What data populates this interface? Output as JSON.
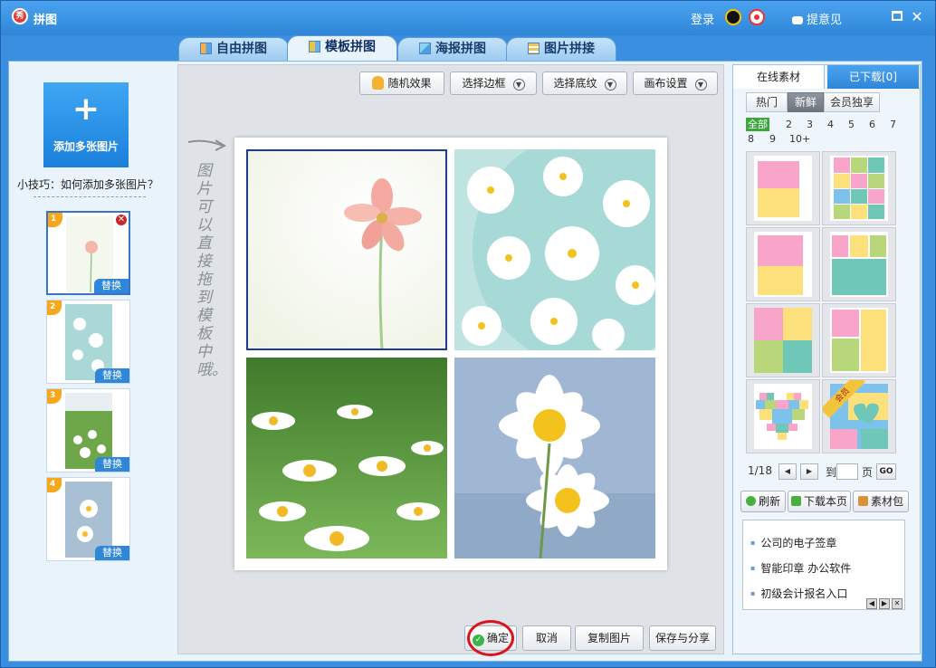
{
  "window": {
    "title": "拼图",
    "logo_text": "秀",
    "login": "登录",
    "feedback": "提意见",
    "maximize_icon": "maximize-icon",
    "close_icon": "close-icon"
  },
  "tabs": [
    {
      "label": "自由拼图",
      "active": false
    },
    {
      "label": "模板拼图",
      "active": true
    },
    {
      "label": "海报拼图",
      "active": false
    },
    {
      "label": "图片拼接",
      "active": false
    }
  ],
  "left": {
    "add_plus": "+",
    "add_label": "添加多张图片",
    "tip": "小技巧：如何添加多张图片？",
    "thumbs": [
      {
        "num": "1",
        "replace": "替换",
        "selected": true
      },
      {
        "num": "2",
        "replace": "替换",
        "selected": false
      },
      {
        "num": "3",
        "replace": "替换",
        "selected": false
      },
      {
        "num": "4",
        "replace": "替换",
        "selected": false
      }
    ],
    "delete_icon": "✕"
  },
  "toolbar": {
    "random": "随机效果",
    "border": "选择边框",
    "texture": "选择底纹",
    "canvas": "画布设置"
  },
  "hint": "图片可以直接拖到模板中哦。",
  "bottom": {
    "ok": "确定",
    "cancel": "取消",
    "copy": "复制图片",
    "save_share": "保存与分享"
  },
  "right": {
    "tab_online": "在线素材",
    "tab_downloaded": "已下载[0]",
    "cats": [
      {
        "label": "热门",
        "active": false
      },
      {
        "label": "新鲜",
        "active": true
      },
      {
        "label": "会员独享",
        "active": false
      }
    ],
    "counts_row1": [
      "全部",
      "2",
      "3",
      "4",
      "5",
      "6",
      "7"
    ],
    "counts_row2": [
      "8",
      "9",
      "10+"
    ],
    "vip": "会员",
    "pager": {
      "page": "1/18",
      "to": "到",
      "page_unit": "页",
      "go": "GO"
    },
    "refresh": "刷新",
    "download_page": "下载本页",
    "material_pack": "素材包",
    "news": [
      "公司的电子签章",
      "智能印章 办公软件",
      "初级会计报名入口"
    ]
  },
  "colors": {
    "accent": "#2f86d8",
    "tpl_pink": "#f8a5c9",
    "tpl_yellow": "#fbe07c",
    "tpl_green": "#b8d67a",
    "tpl_teal": "#6fc7b7",
    "tpl_blue": "#7cc2ea",
    "ok_highlight": "#d8141c"
  }
}
